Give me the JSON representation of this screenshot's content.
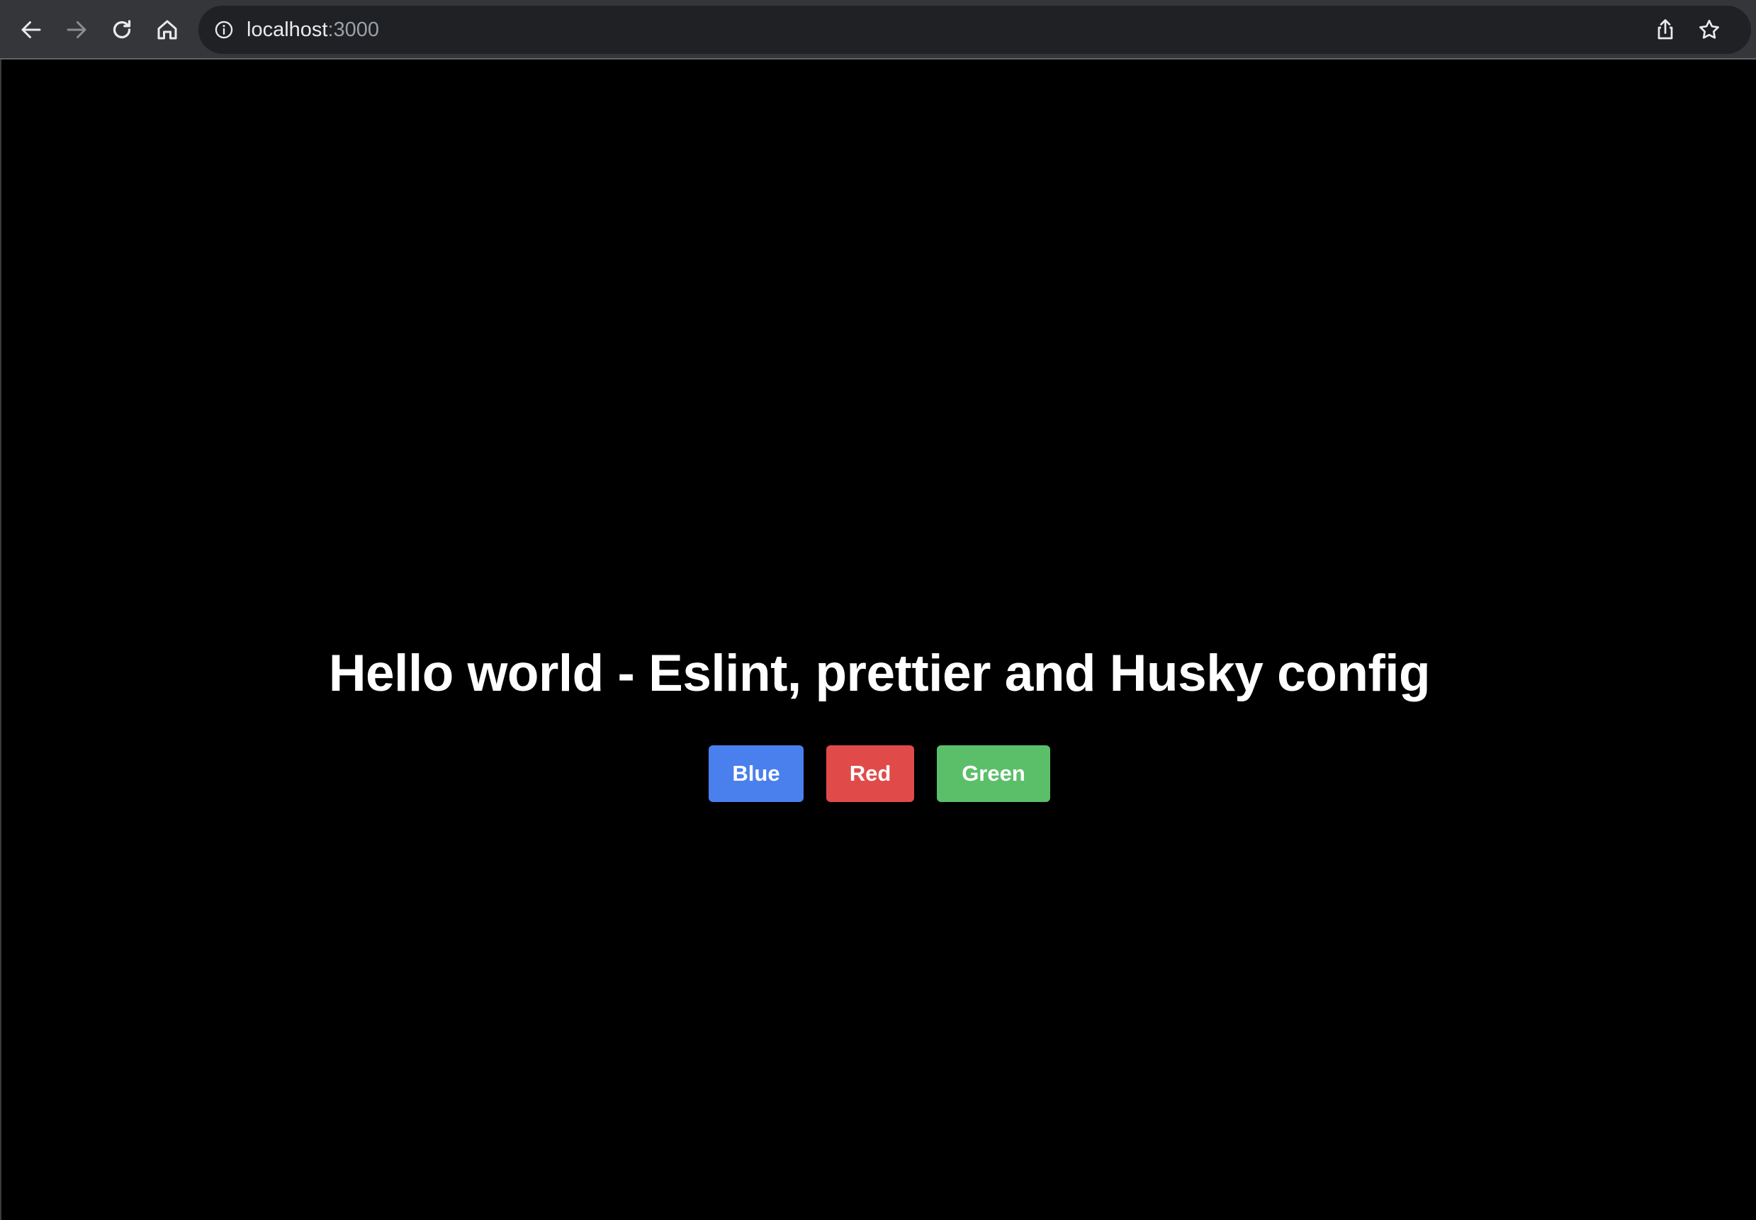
{
  "browser": {
    "url_host": "localhost",
    "url_port": ":3000",
    "icons": {
      "back": "arrow-left-icon",
      "forward": "arrow-right-icon",
      "reload": "reload-icon",
      "home": "home-icon",
      "info": "info-icon",
      "share": "share-icon",
      "bookmark": "star-icon"
    }
  },
  "page": {
    "title": "Hello world - Eslint, prettier and Husky config",
    "buttons": [
      {
        "label": "Blue",
        "color": "#4a7fee"
      },
      {
        "label": "Red",
        "color": "#e04b4a"
      },
      {
        "label": "Green",
        "color": "#5bbf6a"
      }
    ],
    "background_color": "#000000"
  }
}
